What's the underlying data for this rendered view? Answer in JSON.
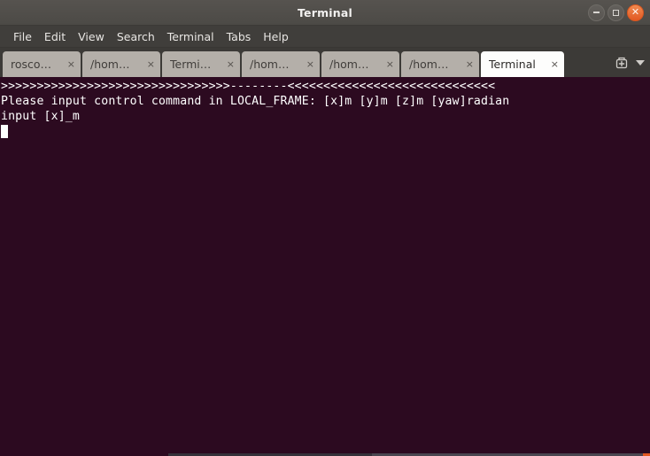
{
  "window": {
    "title": "Terminal",
    "controls": {
      "minimize_label": "–",
      "maximize_label": "□",
      "close_label": "✕"
    },
    "colors": {
      "titlebar": "#4f4d49",
      "menubar": "#403e3b",
      "tabbar": "#3c3a37",
      "tab_inactive": "#b4afa9",
      "tab_active": "#fdfdfc",
      "terminal_bg": "#2c0a20",
      "terminal_fg": "#ffffff",
      "close_button": "#e25822"
    }
  },
  "menubar": {
    "items": [
      {
        "label": "File"
      },
      {
        "label": "Edit"
      },
      {
        "label": "View"
      },
      {
        "label": "Search"
      },
      {
        "label": "Terminal"
      },
      {
        "label": "Tabs"
      },
      {
        "label": "Help"
      }
    ]
  },
  "tabbar": {
    "tabs": [
      {
        "label": "rosco…",
        "close": "×",
        "active": false
      },
      {
        "label": "/hom…",
        "close": "×",
        "active": false
      },
      {
        "label": "Termi…",
        "close": "×",
        "active": false
      },
      {
        "label": "/hom…",
        "close": "×",
        "active": false
      },
      {
        "label": "/hom…",
        "close": "×",
        "active": false
      },
      {
        "label": "/hom…",
        "close": "×",
        "active": false
      },
      {
        "label": "Terminal",
        "close": "×",
        "active": true
      }
    ],
    "new_tab_icon": "new-tab-icon",
    "dropdown_icon": "chevron-down-icon"
  },
  "terminal": {
    "lines": [
      ">>>>>>>>>>>>>>>>>>>>>>>>>>>>>>>>--------<<<<<<<<<<<<<<<<<<<<<<<<<<<<<",
      "Please input control command in LOCAL_FRAME: [x]m [y]m [z]m [yaw]radian",
      "input [x]_m"
    ],
    "cursor": {
      "row": 3,
      "column": 0,
      "shape": "block"
    }
  }
}
